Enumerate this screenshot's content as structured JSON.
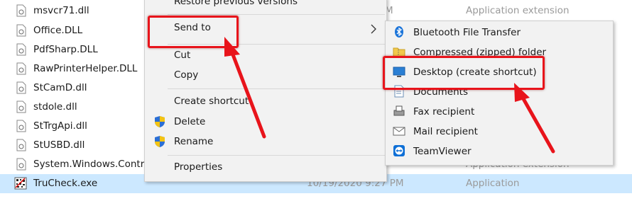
{
  "files": [
    {
      "name": "msvcr71.dll",
      "date": "",
      "type": "Application extension",
      "date_partial": "M"
    },
    {
      "name": "Office.DLL",
      "date": "",
      "type": ""
    },
    {
      "name": "PdfSharp.DLL",
      "date": "",
      "type": ""
    },
    {
      "name": "RawPrinterHelper.DLL",
      "date": "",
      "type": ""
    },
    {
      "name": "StCamD.dll",
      "date": "",
      "type": ""
    },
    {
      "name": "stdole.dll",
      "date": "",
      "type": ""
    },
    {
      "name": "StTrgApi.dll",
      "date": "",
      "type": ""
    },
    {
      "name": "StUSBD.dll",
      "date": "",
      "type": ""
    },
    {
      "name": "System.Windows.Controls",
      "date": "",
      "type": "Application extension"
    },
    {
      "name": "TruCheck.exe",
      "date": "10/19/2020 9:27 PM",
      "type": "Application"
    }
  ],
  "context_menu": {
    "restore_label": "Restore previous versions",
    "send_to_label": "Send to",
    "cut_label": "Cut",
    "copy_label": "Copy",
    "create_shortcut_label": "Create shortcut",
    "delete_label": "Delete",
    "rename_label": "Rename",
    "properties_label": "Properties"
  },
  "send_to_menu": {
    "items": [
      {
        "label": "Bluetooth File Transfer",
        "icon": "bluetooth-icon"
      },
      {
        "label": "Compressed (zipped) folder",
        "icon": "zip-folder-icon"
      },
      {
        "label": "Desktop (create shortcut)",
        "icon": "desktop-icon"
      },
      {
        "label": "Documents",
        "icon": "documents-icon"
      },
      {
        "label": "Fax recipient",
        "icon": "fax-icon"
      },
      {
        "label": "Mail recipient",
        "icon": "mail-icon"
      },
      {
        "label": "TeamViewer",
        "icon": "teamviewer-icon"
      }
    ]
  },
  "colors": {
    "annotation_red": "#e8141b",
    "selection": "#cce8ff",
    "menu_bg": "#f2f2f2"
  }
}
